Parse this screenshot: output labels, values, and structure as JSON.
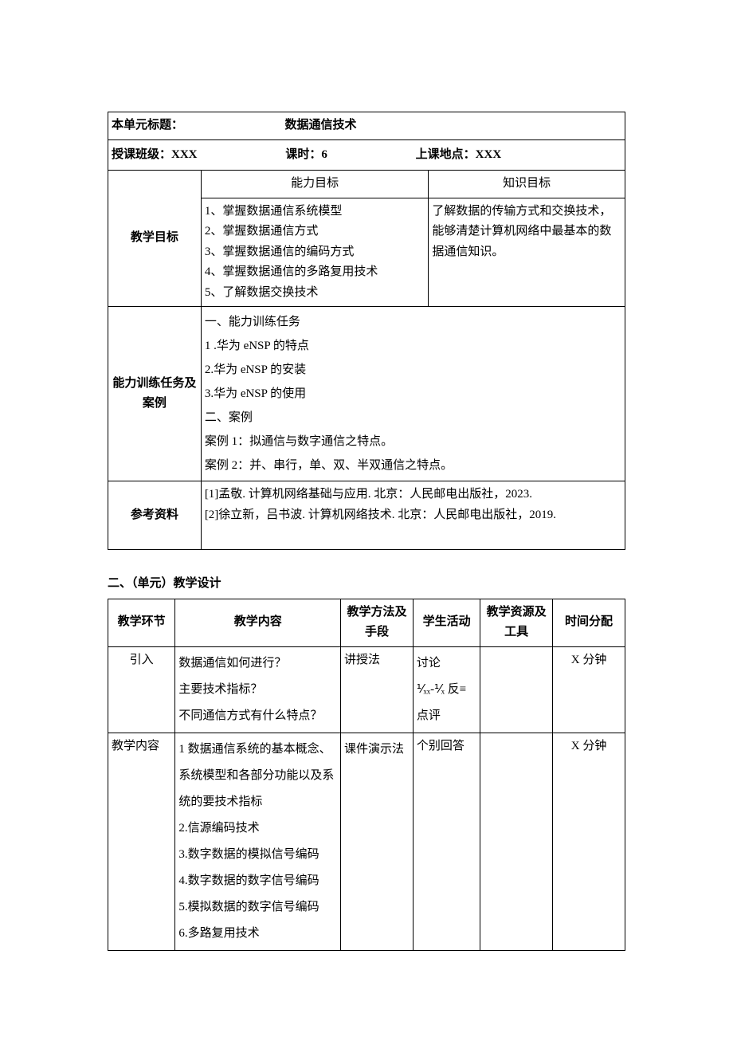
{
  "table1": {
    "row1": {
      "label": "本单元标题：",
      "title": "数据通信技术"
    },
    "row2": {
      "class_label": "授课班级：",
      "class_value": "XXX",
      "hours_label": "课时：",
      "hours_value": "6",
      "place_label": "上课地点：",
      "place_value": "XXX"
    },
    "goals": {
      "row_label": "教学目标",
      "ability_header": "能力目标",
      "knowledge_header": "知识目标",
      "ability_text": "1、掌握数据通信系统模型\n2、掌握数据通信方式\n3、掌握数据通信的编码方式\n4、掌握数据通信的多路复用技术\n5、了解数据交换技术",
      "knowledge_text": "了解数据的传输方式和交换技术，能够清楚计算机网络中最基本的数据通信知识。"
    },
    "tasks": {
      "row_label": "能力训练任务及案例",
      "text": "一、能力训练任务\n1          .华为 eNSP 的特点\n2.华为 eNSP 的安装\n3.华为 eNSP 的使用\n二、案例\n案例 1：拟通信与数字通信之特点。\n案例 2：并、串行，单、双、半双通信之特点。"
    },
    "refs": {
      "row_label": "参考资料",
      "text": "[1]孟敬. 计算机网络基础与应用. 北京：人民邮电出版社，2023.\n[2]徐立新，吕书波. 计算机网络技术. 北京：人民邮电出版社，2019.\n\n"
    }
  },
  "section2_title": "二、（单元）教学设计",
  "table2": {
    "headers": {
      "h1": "教学环节",
      "h2": "教学内容",
      "h3": "教学方法及手段",
      "h4": "学生活动",
      "h5": "教学资源及工具",
      "h6": "时间分配"
    },
    "rows": [
      {
        "c1": "引入",
        "c2": "数据通信如何进行？\n主要技术指标？\n不同通信方式有什么特点？",
        "c3": "讲授法",
        "c4": "讨论\n⅟ₓₓ-⅟ₓ 反≡\n点评",
        "c5": "",
        "c6": "X 分钟"
      },
      {
        "c1": "教学内容",
        "c2": "1 数据通信系统的基本概念、系统模型和各部分功能以及系统的要技术指标\n2.信源编码技术\n3.数字数据的模拟信号编码\n4.数字数据的数字信号编码\n5.模拟数据的数字信号编码\n6.多路复用技术",
        "c3": "课件演示法",
        "c4": "个别回答",
        "c5": "",
        "c6": "X 分钟"
      }
    ]
  }
}
